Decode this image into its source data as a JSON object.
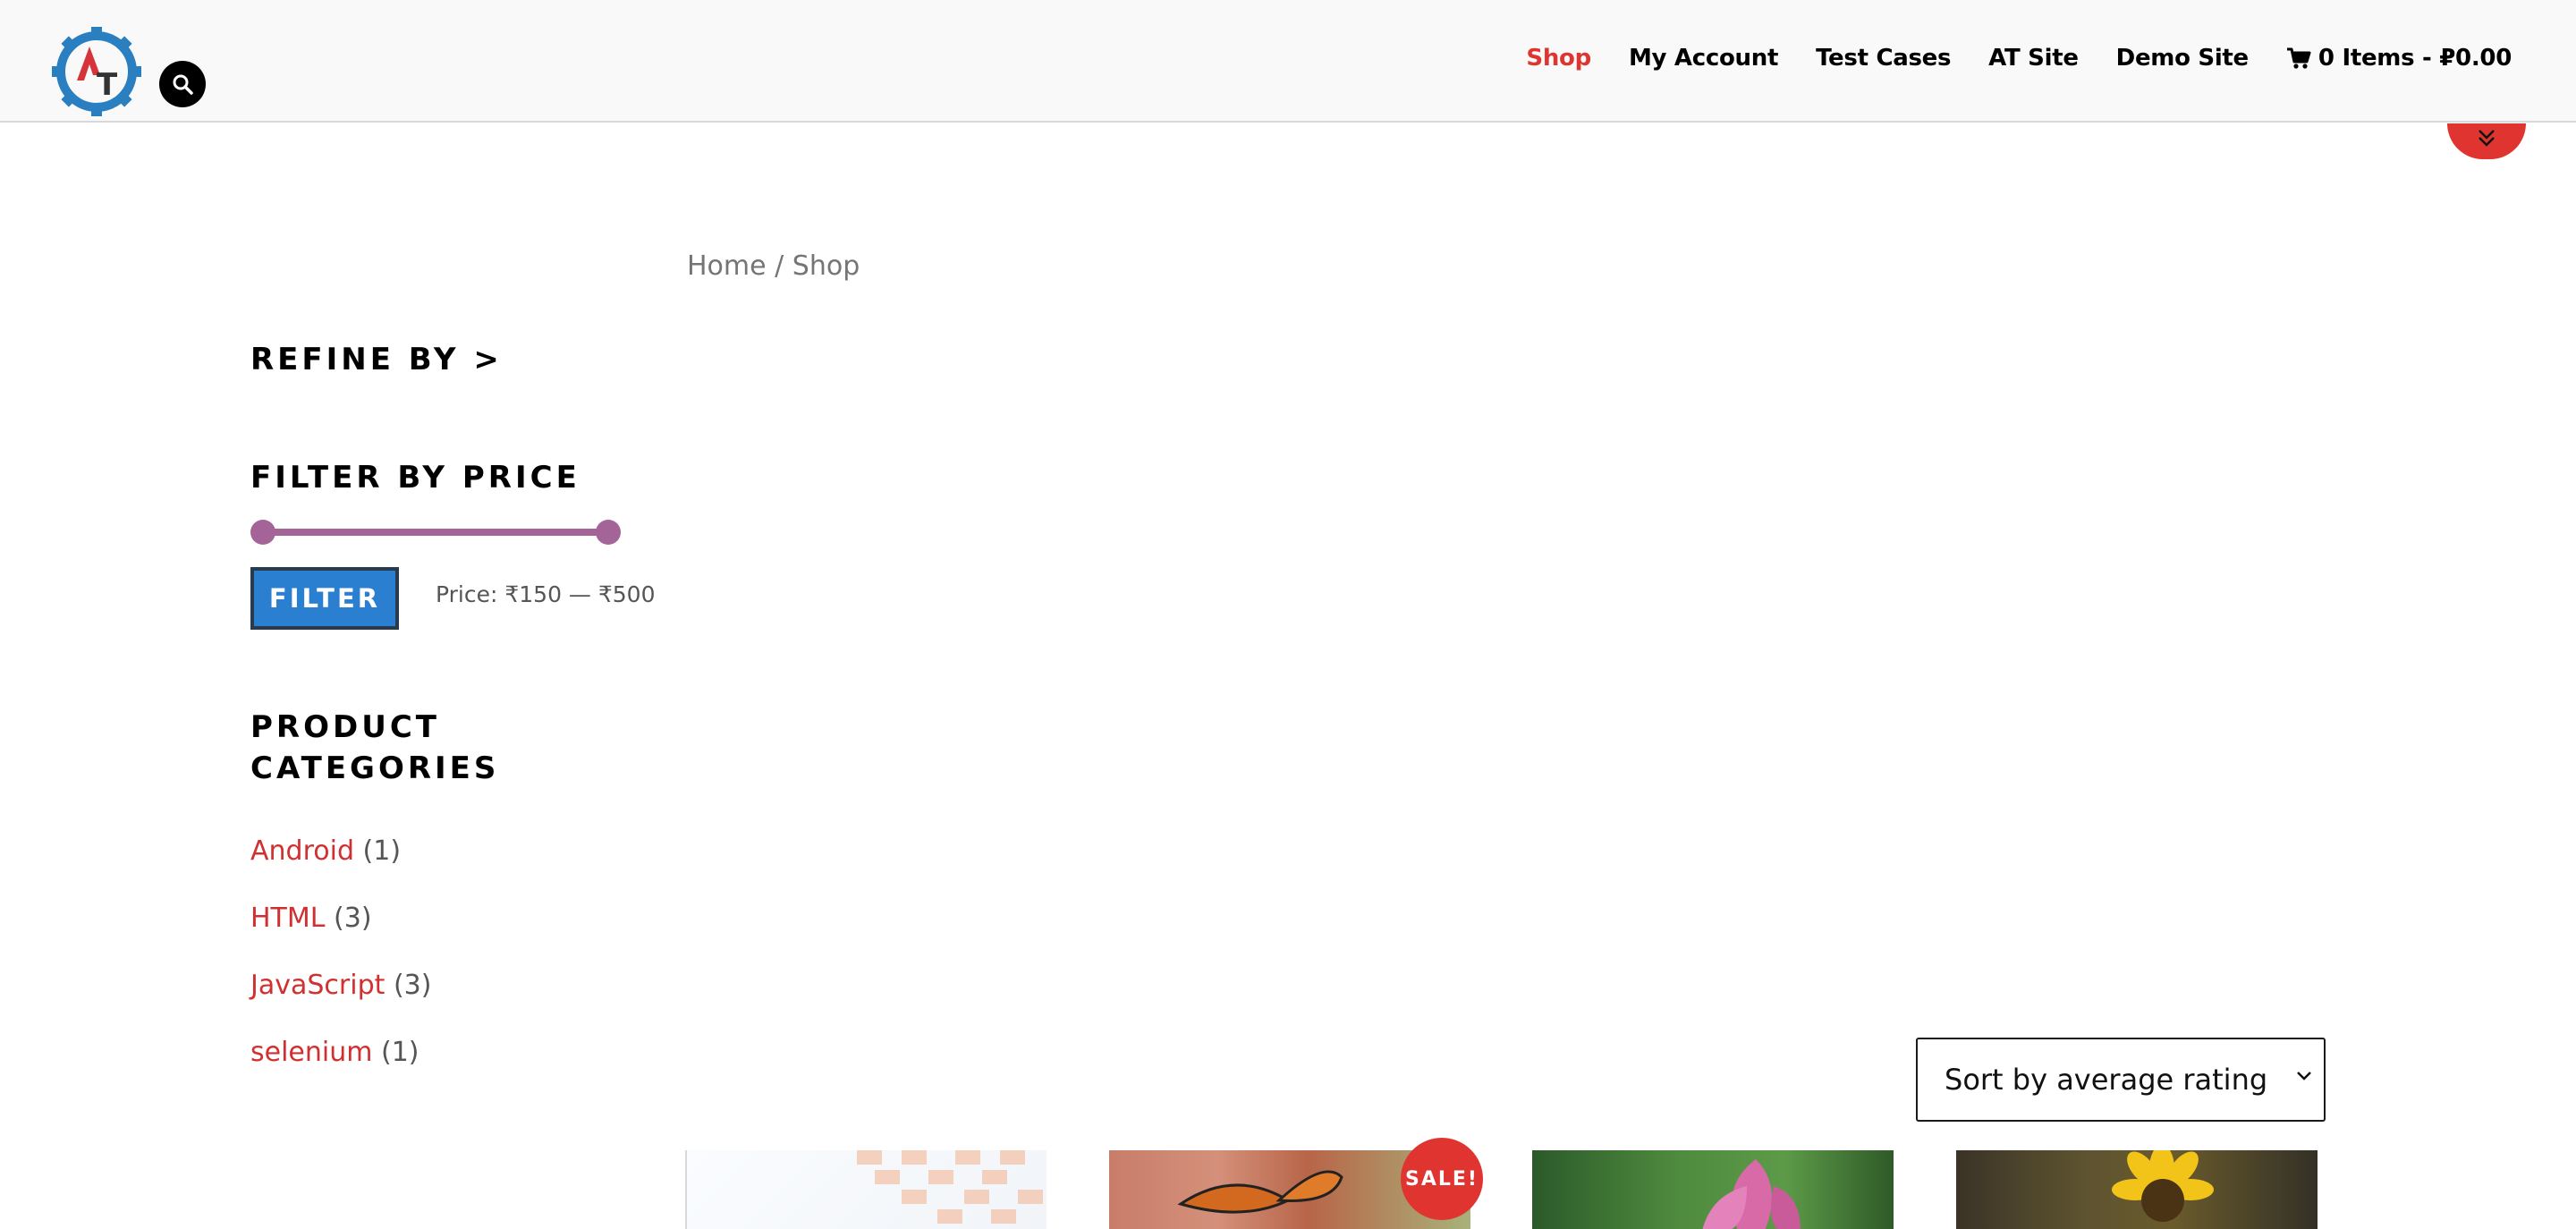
{
  "header": {
    "nav": [
      {
        "label": "Shop",
        "active": true
      },
      {
        "label": "My Account",
        "active": false
      },
      {
        "label": "Test Cases",
        "active": false
      },
      {
        "label": "AT Site",
        "active": false
      },
      {
        "label": "Demo Site",
        "active": false
      }
    ],
    "cart_label": "0 Items - ₽0.00",
    "logo_text": "AT"
  },
  "breadcrumb": {
    "home": "Home",
    "separator": " / ",
    "current": "Shop"
  },
  "sidebar": {
    "refine_title": "REFINE BY >",
    "filter_title": "FILTER BY PRICE",
    "filter_button": "FILTER",
    "price_label": "Price: ₹150 — ₹500",
    "price_range": {
      "min": 150,
      "max": 500
    },
    "categories_title": "PRODUCT CATEGORIES",
    "categories": [
      {
        "name": "Android",
        "count": "(1)"
      },
      {
        "name": "HTML",
        "count": "(3)"
      },
      {
        "name": "JavaScript",
        "count": "(3)"
      },
      {
        "name": "selenium",
        "count": "(1)"
      }
    ]
  },
  "sort": {
    "selected": "Sort by average rating"
  },
  "products": {
    "sale_badge": "SALE!"
  },
  "colors": {
    "accent": "#e03431",
    "slider": "#a46497",
    "button": "#2a7fd0"
  }
}
